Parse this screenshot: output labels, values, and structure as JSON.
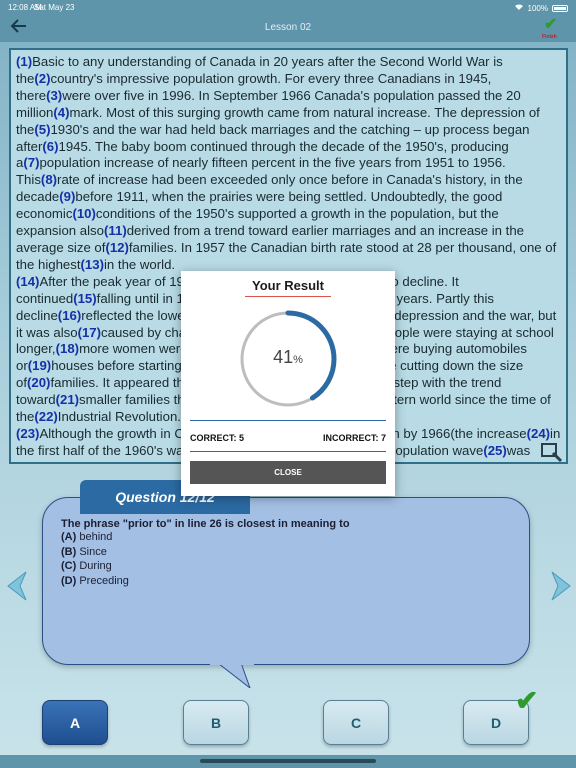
{
  "status_bar": {
    "time": "12:08 AM",
    "date": "Sat May 23",
    "battery": "100%"
  },
  "nav": {
    "title": "Lesson 02",
    "finish_label": "Finish"
  },
  "passage": {
    "segments": [
      {
        "n": "(1)",
        "t": "Basic to any understanding of Canada in 20 years after the Second World War is the"
      },
      {
        "n": "(2)",
        "t": "country's impressive population growth. For every three Canadians in 1945, there"
      },
      {
        "n": "(3)",
        "t": "were over five in 1996. In September 1966 Canada's population passed the 20 million"
      },
      {
        "n": "(4)",
        "t": "mark. Most of this surging growth came from natural increase. The depression of the"
      },
      {
        "n": "(5)",
        "t": "1930's and the war had held back marriages and the catching – up process began after"
      },
      {
        "n": "(6)",
        "t": "1945. The baby boom continued through the decade of the 1950's, producing a"
      },
      {
        "n": "(7)",
        "t": "population increase of nearly fifteen percent in the five years from 1951 to 1956. This"
      },
      {
        "n": "(8)",
        "t": "rate of increase had been exceeded only once before in Canada's history, in the decade"
      },
      {
        "n": "(9)",
        "t": "before 1911, when the prairies were being settled. Undoubtedly, the good economic"
      },
      {
        "n": "(10)",
        "t": "conditions of the 1950's supported a growth in the population, but the expansion also"
      },
      {
        "n": "(11)",
        "t": "derived from a trend toward earlier marriages and an increase in the average size of"
      },
      {
        "n": "(12)",
        "t": "families. In 1957 the Canadian birth rate stood at 28 per thousand, one of the highest"
      },
      {
        "n": "(13)",
        "t": "in the world."
      },
      {
        "n": "(14)",
        "t": "After the peak year of 1957, the birth rate in Canada began to decline. It continued"
      },
      {
        "n": "(15)",
        "t": "falling until in 1966 it stood at the lowest level in 25 years. Partly this decline"
      },
      {
        "n": "(16)",
        "t": "reflected the lower number of women born during the depression and the war, but it was also"
      },
      {
        "n": "(17)",
        "t": "caused by changes in Canadian society. Young people were staying at school longer,"
      },
      {
        "n": "(18)",
        "t": "more women were working; young married couples were buying automobiles or"
      },
      {
        "n": "(19)",
        "t": "houses before starting families; rising living standards were cutting down the size of"
      },
      {
        "n": "(20)",
        "t": "families. It appeared that Canada was once more falling in step with the trend toward"
      },
      {
        "n": "(21)",
        "t": "smaller families that had occurred all through the Western world since the time of the"
      },
      {
        "n": "(22)",
        "t": "Industrial Revolution."
      },
      {
        "n": "(23)",
        "t": "Although the growth in Canada's population had slowed down by 1966(the increase"
      },
      {
        "n": "(24)",
        "t": "in the first half of the 1960's was only nine percent). Another large population wave"
      },
      {
        "n": "(25)",
        "t": "was coming over the horizon. It would be composed of the children"
      }
    ]
  },
  "question": {
    "header": "Question 12/12",
    "stem": "The phrase \"prior to\" in line 26 is closest in meaning to",
    "options": [
      {
        "letter": "(A)",
        "text": "behind"
      },
      {
        "letter": "(B)",
        "text": "Since"
      },
      {
        "letter": "(C)",
        "text": "During"
      },
      {
        "letter": "(D)",
        "text": "Preceding"
      }
    ]
  },
  "answers": {
    "a": "A",
    "b": "B",
    "c": "C",
    "d": "D",
    "selected": "A",
    "correct": "D"
  },
  "result": {
    "title": "Your Result",
    "percent_value": 41,
    "percent_text": "41",
    "percent_sign": "%",
    "correct_label": "CORRECT: 5",
    "incorrect_label": "INCORRECT: 7",
    "close_label": "CLOSE"
  },
  "colors": {
    "accent": "#2b6aa3",
    "gauge_track": "#bdbdbd",
    "correct_green": "#2f9b2f"
  },
  "icons": {
    "back": "arrow-left-icon",
    "finish": "checkmark-icon",
    "zoom": "zoom-icon",
    "prev": "chevron-left-icon",
    "next": "chevron-right-icon"
  }
}
